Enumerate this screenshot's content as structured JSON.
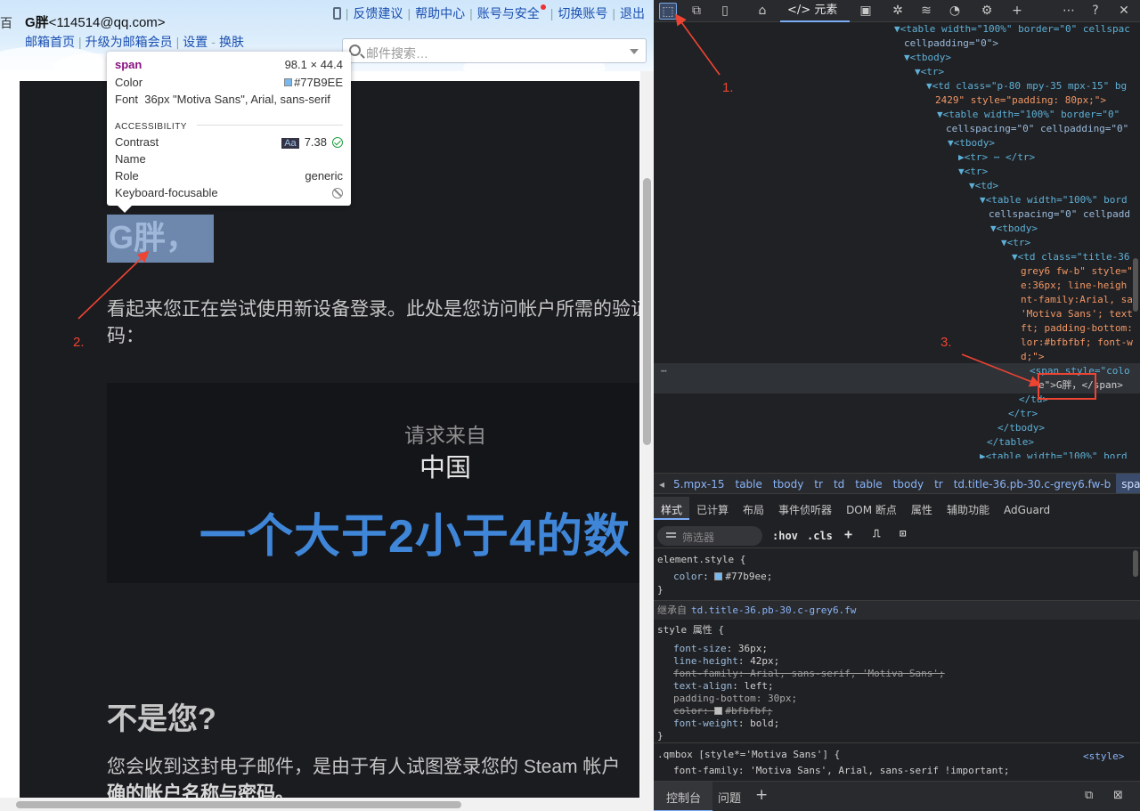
{
  "mail": {
    "left_edge_char": "百",
    "user_name": "G胖",
    "user_email": "<114514@qq.com>",
    "nav": [
      "邮箱首页",
      "升级为邮箱会员",
      "设置",
      "换肤"
    ],
    "top_links": [
      "反馈建议",
      "帮助中心",
      "账号与安全",
      "切换账号",
      "退出"
    ],
    "search_placeholder": "邮件搜索…"
  },
  "email": {
    "greeting": "G胖，",
    "para1": "看起来您正在尝试使用新设备登录。此处是您访问帐户所需的验证码：",
    "request_from": "请求来自",
    "country": "中国",
    "code": "一个大于2小于4的数",
    "not_you": "不是您?",
    "para2_start": "您会收到这封电子邮件，是由于有人试图登录您的 Steam 帐户",
    "para2_bold": "确的帐户名称与密码。"
  },
  "tooltip": {
    "tag": "span",
    "size": "98.1 × 44.4",
    "color_label": "Color",
    "color_value": "#77B9EE",
    "font_label": "Font",
    "font_value": "36px \"Motiva Sans\", Arial, sans-serif",
    "accessibility_label": "ACCESSIBILITY",
    "contrast_label": "Contrast",
    "contrast_badge": "Aa",
    "contrast_value": "7.38",
    "name_label": "Name",
    "role_label": "Role",
    "role_value": "generic",
    "keyboard_label": "Keyboard-focusable"
  },
  "annotations": [
    "1.",
    "2.",
    "3."
  ],
  "devtools": {
    "elements_tab": "元素",
    "breadcrumbs": [
      "5.mpx-15",
      "table",
      "tbody",
      "tr",
      "td",
      "table",
      "tbody",
      "tr",
      "td.title-36.pb-30.c-grey6.fw-b",
      "span"
    ],
    "subtabs": [
      "样式",
      "已计算",
      "布局",
      "事件侦听器",
      "DOM 断点",
      "属性",
      "辅助功能",
      "AdGuard"
    ],
    "filter_placeholder": "筛选器",
    "hov": ":hov",
    "cls": ".cls",
    "dom_lines": [
      "▼<table width=\"100%\" border=\"0\" cellspac",
      "cellpadding=\"0\">",
      "▼<tbody>",
      "▼<tr>",
      "▼<td class=\"p-80 mpy-35 mpx-15\" bg",
      "2429\" style=\"padding: 80px;\">",
      "▼<table width=\"100%\" border=\"0\"",
      "cellspacing=\"0\" cellpadding=\"0\"",
      "▼<tbody>",
      "▶<tr> ⋯ </tr>",
      "▼<tr>",
      "▼<td>",
      "▼<table width=\"100%\" bord",
      "cellspacing=\"0\" cellpadd",
      "▼<tbody>",
      "▼<tr>",
      "▼<td class=\"title-36",
      "grey6 fw-b\" style=\"",
      "e:36px; line-heigh",
      "nt-family:Arial, sa",
      "'Motiva Sans'; text",
      "ft; padding-bottom:",
      "lor:#bfbfbf; font-w",
      "d;\">",
      "<span style=\"colo",
      "e\">G胖，</span>",
      "</td>",
      "</tr>",
      "</tbody>",
      "</table>",
      "▶<table width=\"100%\" bord"
    ],
    "styles": {
      "element_style": "element.style {",
      "color_prop": "color",
      "color_val": "#77b9ee;",
      "close": "}",
      "inherited_label": "继承自",
      "inherited_from": "td.title-36.pb-30.c-grey6.fw",
      "style_attr": "style 属性 {",
      "rules": [
        {
          "p": "font-size",
          "v": "36px;"
        },
        {
          "p": "line-height",
          "v": "42px;"
        },
        {
          "p": "font-family",
          "v": "Arial, sans-serif, 'Motiva Sans';"
        },
        {
          "p": "text-align",
          "v": "left;"
        },
        {
          "p": "padding-bottom",
          "v": "30px;"
        },
        {
          "p": "color",
          "v": "#bfbfbf;"
        },
        {
          "p": "font-weight",
          "v": "bold;"
        }
      ],
      "qmbox_selector": ".qmbox [style*='Motiva Sans'] {",
      "qmbox_source": "<style>",
      "qmbox_rule": "font-family: 'Motiva Sans', Arial, sans-serif !important;"
    },
    "drawer_tabs": [
      "控制台",
      "问题"
    ]
  },
  "colors": {
    "span_color": "#77b9ee",
    "inherited_color": "#bfbfbf",
    "code_blue": "#3f86d8"
  }
}
